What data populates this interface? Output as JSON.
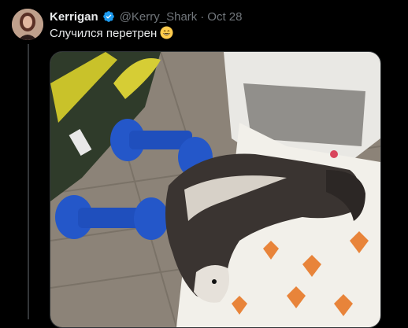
{
  "tweet": {
    "author_name": "Kerrigan",
    "handle": "@Kerry_Shark",
    "separator": "·",
    "date": "Oct 28",
    "text": "Случился перетрен",
    "verified": true
  },
  "icons": {
    "verified": "verified-badge-icon",
    "emoji": "grinning-face-emoji"
  },
  "colors": {
    "background": "#000000",
    "text_primary": "#e7e9ea",
    "text_secondary": "#71767b",
    "verified_blue": "#1d9bf0",
    "thread_line": "#333639"
  }
}
